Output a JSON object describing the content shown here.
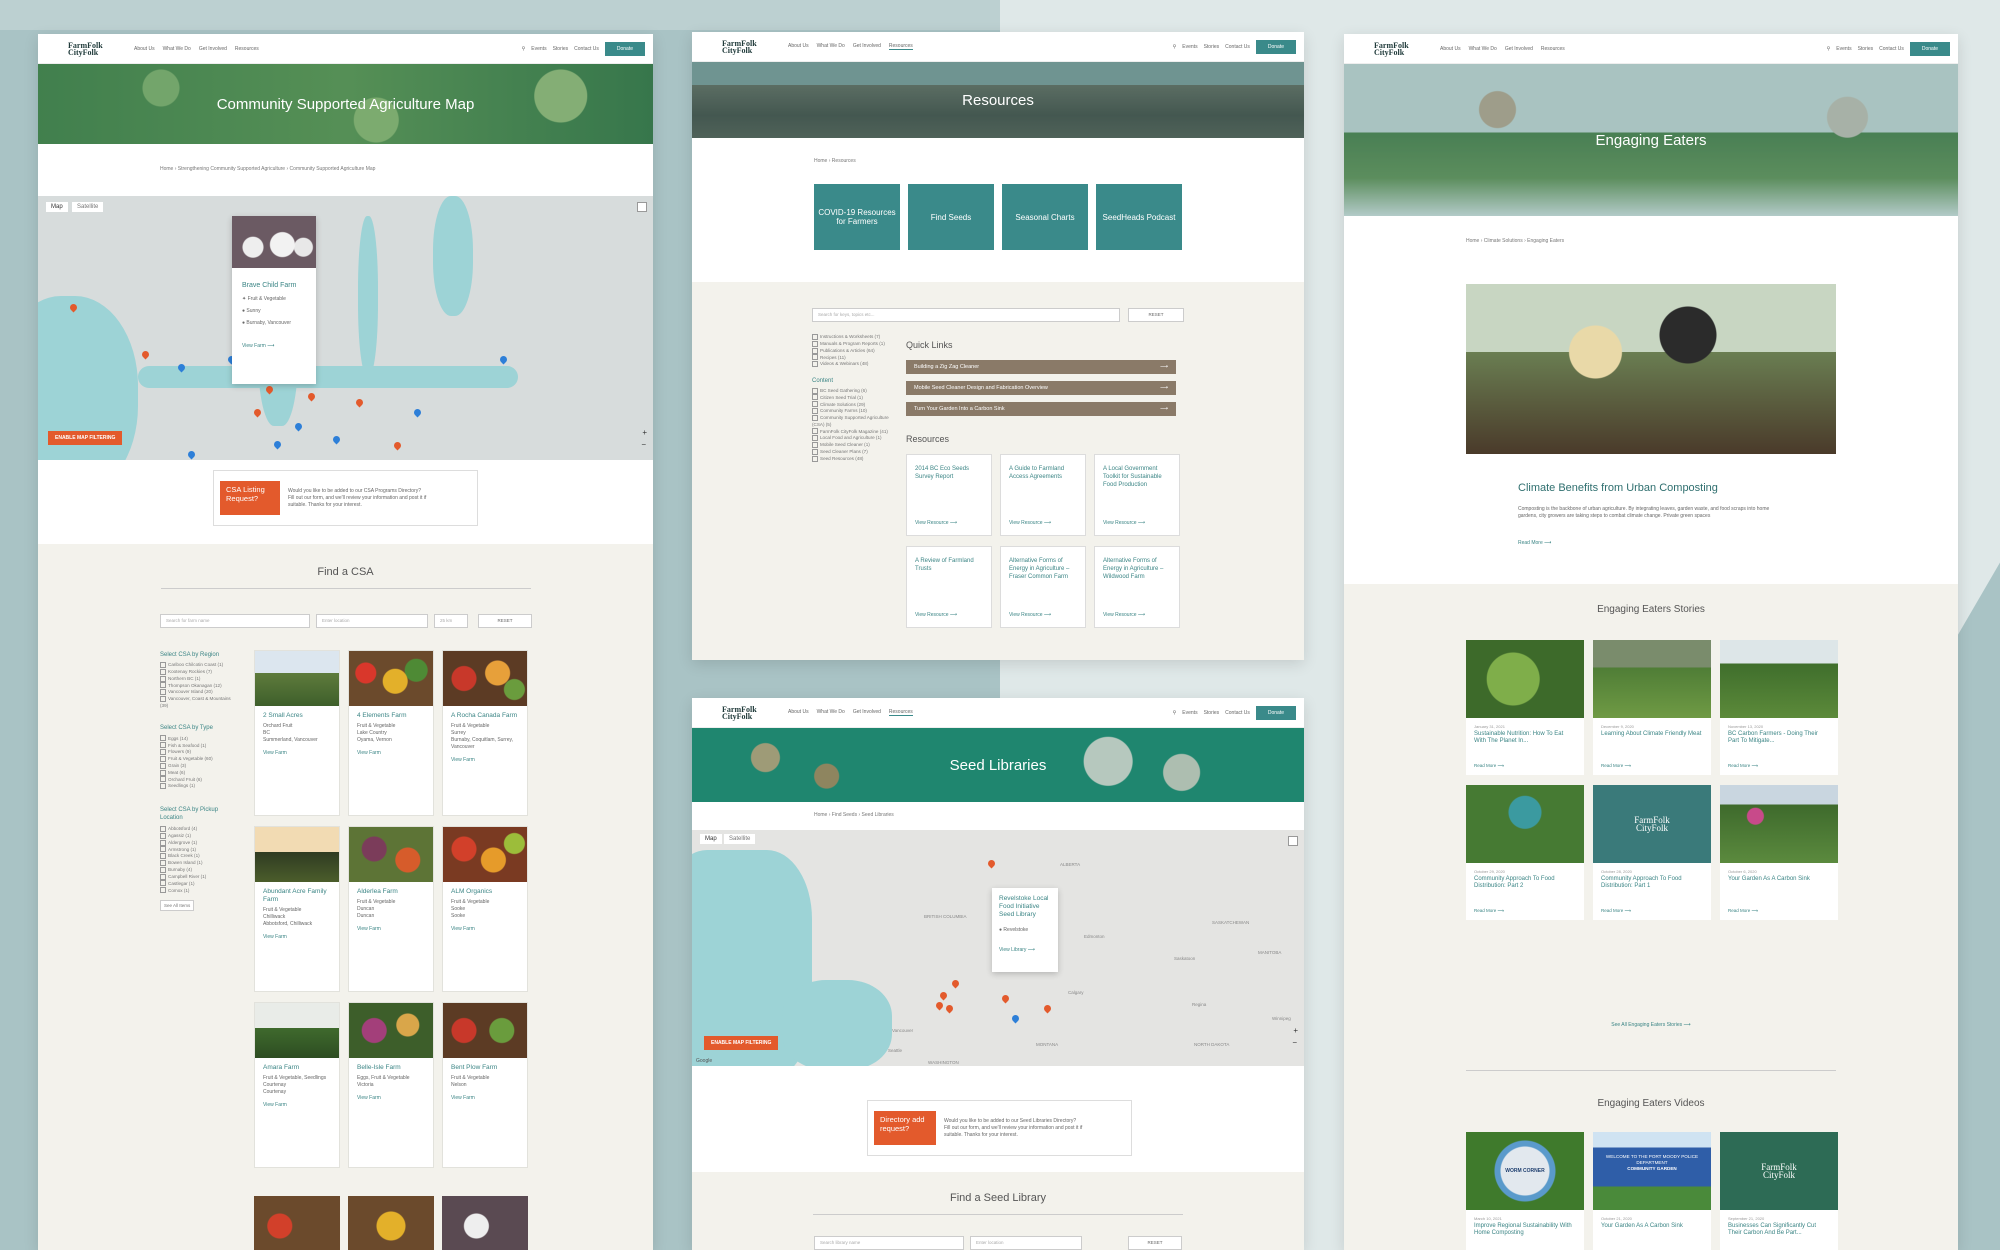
{
  "site": {
    "logo_line1": "FarmFolk",
    "logo_line2": "CityFolk",
    "nav": [
      "About Us",
      "What We Do",
      "Get Involved",
      "Resources"
    ],
    "nav_right": [
      "Events",
      "Stories",
      "Contact Us"
    ],
    "donate": "Donate"
  },
  "csa_page": {
    "hero_title": "Community Supported Agriculture Map",
    "breadcrumb": [
      "Home",
      "Strengthening Community Supported Agriculture",
      "Community Supported Agriculture Map"
    ],
    "map_tabs": [
      "Map",
      "Satellite"
    ],
    "popup": {
      "title": "Brave Child Farm",
      "type": "Fruit & Vegetable",
      "pickup": "Sunny",
      "location": "Burnaby, Vancouver",
      "link": "View Farm"
    },
    "filter_button": "ENABLE MAP FILTERING",
    "listing_box": {
      "title": "CSA Listing Request?",
      "question": "Would you like to be added to our CSA Programs Directory?",
      "line2": "Fill out our form, and we'll review your information and post it if",
      "line3": "suitable. Thanks for your interest."
    },
    "find_title": "Find a CSA",
    "search_placeholder": "Search for farm name",
    "location_placeholder": "Enter location",
    "distance": "25 km",
    "reset": "RESET",
    "filter_groups": [
      {
        "title": "Select CSA by Region",
        "items": [
          "Cariboo Chilcotin Coast (1)",
          "Kootenay Rockies (7)",
          "Northern BC (1)",
          "Thompson Okanagan (12)",
          "Vancouver Island (20)",
          "Vancouver, Coast & Mountains (39)"
        ]
      },
      {
        "title": "Select CSA by Type",
        "items": [
          "Eggs (14)",
          "Fish & Seafood (1)",
          "Flowers (9)",
          "Fruit & Vegetable (60)",
          "Grain (3)",
          "Meat (6)",
          "Orchard Fruit (6)",
          "Seedlings (1)"
        ]
      },
      {
        "title": "Select CSA by Pickup Location",
        "items": [
          "Abbotsford (4)",
          "Agassiz (1)",
          "Aldergrove (1)",
          "Armstrong (1)",
          "Black Creek (1)",
          "Bowen Island (1)",
          "Burnaby (4)",
          "Campbell River (1)",
          "Castlegar (1)",
          "Comox (1)"
        ]
      }
    ],
    "see_all": "See All Items",
    "farms": [
      {
        "name": "2 Small Acres",
        "type": "Orchard Fruit",
        "pickup": "BC",
        "loc": "Summerland, Vancouver",
        "link": "View Farm"
      },
      {
        "name": "4 Elements Farm",
        "type": "Fruit & Vegetable",
        "pickup": "Lake Country",
        "loc": "Oyama, Vernon",
        "link": "View Farm"
      },
      {
        "name": "A Rocha Canada Farm",
        "type": "Fruit & Vegetable",
        "pickup": "Surrey",
        "loc": "Burnaby, Coquitlam, Surrey, Vancouver",
        "link": "View Farm"
      },
      {
        "name": "Abundant Acre Family Farm",
        "type": "Fruit & Vegetable",
        "pickup": "Chilliwack",
        "loc": "Abbotsford, Chilliwack",
        "link": "View Farm"
      },
      {
        "name": "Alderlea Farm",
        "type": "Fruit & Vegetable",
        "pickup": "Duncan",
        "loc": "Duncan",
        "link": "View Farm"
      },
      {
        "name": "ALM Organics",
        "type": "Fruit & Vegetable",
        "pickup": "Sooke",
        "loc": "Sooke",
        "link": "View Farm"
      },
      {
        "name": "Amara Farm",
        "type": "Fruit & Vegetable, Seedlings",
        "pickup": "Courtenay",
        "loc": "Courtenay",
        "link": "View Farm"
      },
      {
        "name": "Belle-Isle Farm",
        "type": "Eggs, Fruit & Vegetable",
        "pickup": "Victoria",
        "loc": "",
        "link": "View Farm"
      },
      {
        "name": "Bent Plow Farm",
        "type": "Fruit & Vegetable",
        "pickup": "Nelson",
        "loc": "",
        "link": "View Farm"
      }
    ]
  },
  "resources_page": {
    "hero_title": "Resources",
    "breadcrumb": [
      "Home",
      "Resources"
    ],
    "tiles": [
      "COVID-19 Resources for Farmers",
      "Find Seeds",
      "Seasonal Charts",
      "SeedHeads Podcast"
    ],
    "search_placeholder": "Search for keys, topics etc...",
    "reset": "RESET",
    "types": [
      "Instructions & Worksheets (7)",
      "Manuals & Program Reports (1)",
      "Publications & Articles (64)",
      "Recipes (11)",
      "Videos & Webinars (48)"
    ],
    "content_label": "Content",
    "content_items": [
      "BC Seed Gathering (6)",
      "Citizen Seed Trial (1)",
      "Climate Solutions (29)",
      "Community Farms (10)",
      "Community Supported Agriculture (CSA) (5)",
      "FarmFolk CityFolk Magazine (41)",
      "Local Food and Agriculture (1)",
      "Mobile Seed Cleaner (1)",
      "Seed Cleaner Plans (7)",
      "Seed Resources (48)"
    ],
    "quick_links_title": "Quick Links",
    "quick_links": [
      "Building a Zig Zag Cleaner",
      "Mobile Seed Cleaner Design and Fabrication Overview",
      "Turn Your Garden Into a Carbon Sink"
    ],
    "resources_title": "Resources",
    "resources": [
      "2014 BC Eco Seeds Survey Report",
      "A Guide to Farmland Access Agreements",
      "A Local Government Toolkit for Sustainable Food Production",
      "A Review of Farmland Trusts",
      "Alternative Forms of Energy in Agriculture – Fraser Common Farm",
      "Alternative Forms of Energy in Agriculture – Wildwood Farm"
    ],
    "view_resource": "View Resource"
  },
  "seed_page": {
    "hero_title": "Seed Libraries",
    "breadcrumb": [
      "Home",
      "Find Seeds",
      "Seed Libraries"
    ],
    "map_tabs": [
      "Map",
      "Satellite"
    ],
    "popup": {
      "title": "Revelstoke Local Food Initiative Seed Library",
      "location": "Revelstoke",
      "link": "View Library"
    },
    "map_labels": [
      "ALBERTA",
      "BRITISH COLUMBIA",
      "SASKATCHEWAN",
      "Edmonton",
      "Calgary",
      "Regina",
      "Saskatoon",
      "Winnipeg",
      "MANITOBA",
      "WASHINGTON",
      "MONTANA",
      "NORTH DAKOTA",
      "Vancouver",
      "Seattle"
    ],
    "filter_button": "ENABLE MAP FILTERING",
    "google": "Google",
    "listing_box": {
      "title": "Directory add request?",
      "question": "Would you like to be added to our Seed Libraries Directory?",
      "line2": "Fill out our form, and we'll review your information and post it if",
      "line3": "suitable. Thanks for your interest."
    },
    "find_title": "Find a Seed Library",
    "search_placeholder": "Search library name",
    "location_placeholder": "Enter location",
    "reset": "RESET"
  },
  "eaters_page": {
    "hero_title": "Engaging Eaters",
    "breadcrumb": [
      "Home",
      "Climate Solutions",
      "Engaging Eaters"
    ],
    "feature_title": "Climate Benefits from Urban Composting",
    "feature_text": "Composting is the backbone of urban agriculture. By integrating leaves, garden waste, and food scraps into home gardens, city growers are taking steps to combat climate change. Private green spaces",
    "read_more": "Read More",
    "stories_title": "Engaging Eaters Stories",
    "stories": [
      {
        "date": "January 31, 2021",
        "title": "Sustainable Nutrition: How To Eat With The Planet In..."
      },
      {
        "date": "December 9, 2020",
        "title": "Learning About Climate Friendly Meat"
      },
      {
        "date": "November 13, 2020",
        "title": "BC Carbon Farmers - Doing Their Part To Mitigate..."
      },
      {
        "date": "October 29, 2020",
        "title": "Community Approach To Food Distribution: Part 2"
      },
      {
        "date": "October 28, 2020",
        "title": "Community Approach To Food Distribution: Part 1"
      },
      {
        "date": "October 6, 2020",
        "title": "Your Garden As A Carbon Sink"
      }
    ],
    "see_all": "See All Engaging Eaters Stories",
    "videos_title": "Engaging Eaters Videos",
    "videos": [
      {
        "date": "March 10, 2021",
        "title": "Improve Regional Sustainability With Home Composting"
      },
      {
        "date": "October 21, 2020",
        "title": "Your Garden As A Carbon Sink"
      },
      {
        "date": "September 21, 2020",
        "title": "Businesses Can Significantly Cut Their Carbon And Be Part..."
      }
    ],
    "sign1": "WELCOME TO THE PORT MOODY POLICE DEPARTMENT",
    "sign2": "COMMUNITY GARDEN",
    "sign3": "WORM CORNER"
  },
  "colors": {
    "teal": "#3a8a8a",
    "orange": "#e35a2c",
    "brown": "#8a7a68",
    "background": "#a9c3c5"
  }
}
